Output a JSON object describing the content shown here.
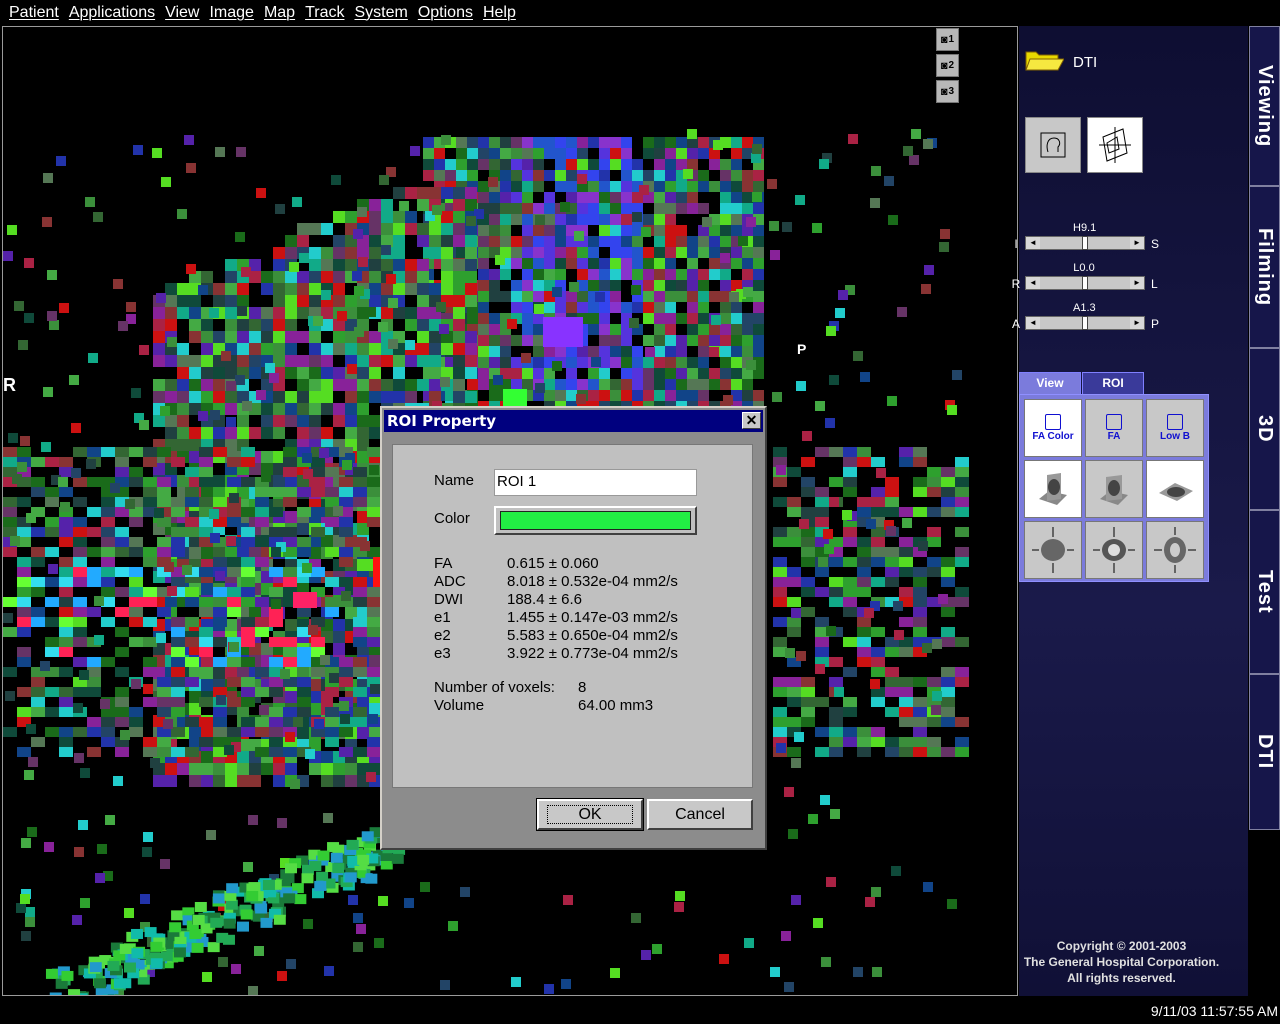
{
  "menu": [
    "Patient",
    "Applications",
    "View",
    "Image",
    "Map",
    "Track",
    "System",
    "Options",
    "Help"
  ],
  "viewport": {
    "left_label": "R",
    "right_label": "P",
    "snapshot_buttons": [
      "1",
      "2",
      "3"
    ]
  },
  "panel": {
    "folder_label": "DTI",
    "sliders": [
      {
        "value": "H9.1",
        "left": "I",
        "right": "S",
        "thumb": 0.5
      },
      {
        "value": "L0.0",
        "left": "R",
        "right": "L",
        "thumb": 0.5
      },
      {
        "value": "A1.3",
        "left": "A",
        "right": "P",
        "thumb": 0.5
      }
    ],
    "tabs": [
      "View",
      "ROI"
    ],
    "view_buttons": [
      "FA Color",
      "FA",
      "Low B"
    ],
    "copyright": [
      "Copyright © 2001-2003",
      "The General Hospital Corporation.",
      "All rights reserved."
    ]
  },
  "side_tabs": [
    "Viewing",
    "Filming",
    "3D",
    "Test",
    "DTI"
  ],
  "status": {
    "timestamp": "9/11/03 11:57:55 AM"
  },
  "dialog": {
    "title": "ROI Property",
    "name_label": "Name",
    "name_value": "ROI 1",
    "color_label": "Color",
    "color_value": "#22ee44",
    "stats": [
      {
        "k": "FA",
        "v": "0.615 ± 0.060"
      },
      {
        "k": "ADC",
        "v": "8.018 ± 0.532e-04  mm2/s"
      },
      {
        "k": "DWI",
        "v": "188.4 ± 6.6"
      },
      {
        "k": "e1",
        "v": "1.455 ± 0.147e-03  mm2/s"
      },
      {
        "k": "e2",
        "v": "5.583 ± 0.650e-04  mm2/s"
      },
      {
        "k": "e3",
        "v": "3.922 ± 0.773e-04  mm2/s"
      }
    ],
    "voxels_label": "Number of voxels:",
    "voxels_value": "8",
    "volume_label": "Volume",
    "volume_value": "64.00  mm3",
    "ok_label": "OK",
    "cancel_label": "Cancel"
  }
}
